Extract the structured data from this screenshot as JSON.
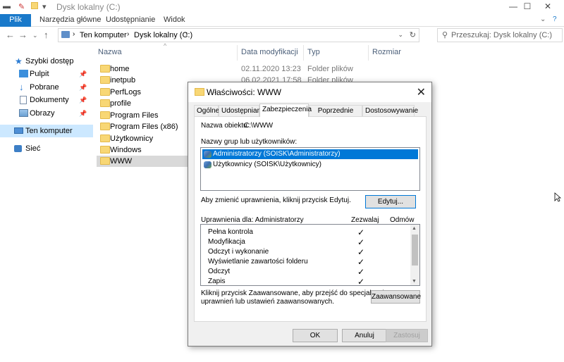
{
  "window": {
    "title": "Dysk lokalny (C:)",
    "controls": {
      "minimize": "—",
      "maximize": "☐",
      "close": "✕"
    }
  },
  "ribbon": {
    "tabs": [
      "Plik",
      "Narzędzia główne",
      "Udostępnianie",
      "Widok"
    ]
  },
  "address": {
    "segments": [
      "Ten komputer",
      "Dysk lokalny (C:)"
    ],
    "search_placeholder": "Przeszukaj: Dysk lokalny (C:)"
  },
  "nav": {
    "quick_access": "Szybki dostęp",
    "pinned": [
      "Pulpit",
      "Pobrane",
      "Dokumenty",
      "Obrazy"
    ],
    "this_pc": "Ten komputer",
    "network": "Sieć"
  },
  "columns": [
    "Nazwa",
    "Data modyfikacji",
    "Typ",
    "Rozmiar"
  ],
  "files": [
    {
      "name": "home",
      "date": "02.11.2020 13:23",
      "type": "Folder plików"
    },
    {
      "name": "inetpub",
      "date": "06.02.2021 17:58",
      "type": "Folder plików"
    },
    {
      "name": "PerfLogs",
      "date": "",
      "type": ""
    },
    {
      "name": "profile",
      "date": "",
      "type": ""
    },
    {
      "name": "Program Files",
      "date": "",
      "type": ""
    },
    {
      "name": "Program Files (x86)",
      "date": "",
      "type": ""
    },
    {
      "name": "Użytkownicy",
      "date": "",
      "type": ""
    },
    {
      "name": "Windows",
      "date": "",
      "type": ""
    },
    {
      "name": "WWW",
      "date": "",
      "type": ""
    }
  ],
  "selected_file": "WWW",
  "dialog": {
    "title": "Właściwości: WWW",
    "tabs": [
      "Ogólne",
      "Udostępnianie",
      "Zabezpieczenia",
      "Poprzednie wersje",
      "Dostosowywanie"
    ],
    "active_tab": "Zabezpieczenia",
    "object_label": "Nazwa obiektu:",
    "object_value": "C:\\WWW",
    "groups_label": "Nazwy grup lub użytkowników:",
    "groups": [
      "Administratorzy (SOISK\\Administratorzy)",
      "Użytkownicy (SOISK\\Użytkownicy)"
    ],
    "change_hint": "Aby zmienić uprawnienia, kliknij przycisk Edytuj.",
    "edit_button": "Edytuj...",
    "perm_for": "Uprawnienia dla: Administratorzy",
    "allow_col": "Zezwalaj",
    "deny_col": "Odmów",
    "permissions": [
      {
        "name": "Pełna kontrola",
        "allow": "✓"
      },
      {
        "name": "Modyfikacja",
        "allow": "✓"
      },
      {
        "name": "Odczyt i wykonanie",
        "allow": "✓"
      },
      {
        "name": "Wyświetlanie zawartości folderu",
        "allow": "✓"
      },
      {
        "name": "Odczyt",
        "allow": "✓"
      },
      {
        "name": "Zapis",
        "allow": "✓"
      }
    ],
    "advanced_hint_1": "Kliknij przycisk Zaawansowane, aby przejść do specjalnych",
    "advanced_hint_2": "uprawnień lub ustawień zaawansowanych.",
    "advanced_button": "Zaawansowane",
    "ok": "OK",
    "cancel": "Anuluj",
    "apply": "Zastosuj"
  }
}
